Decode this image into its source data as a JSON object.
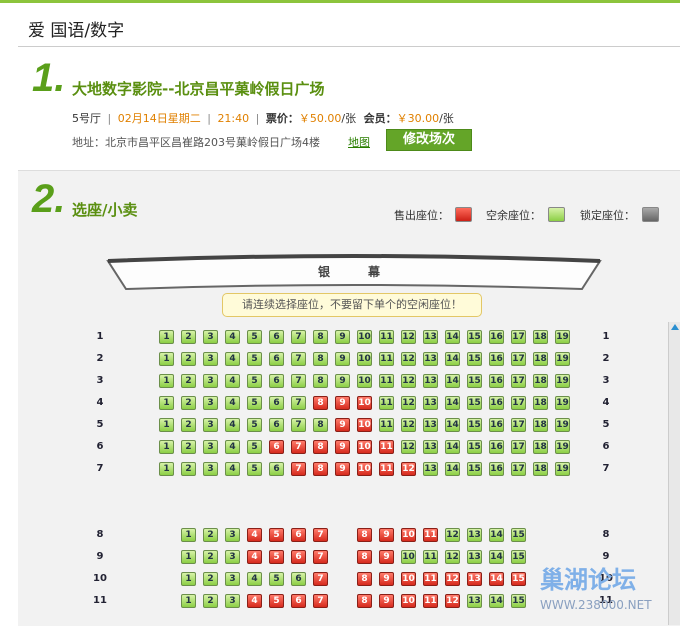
{
  "title": "爱 国语/数字",
  "step1": {
    "num": "1.",
    "cinema": "大地数字影院--北京昌平菓岭假日广场",
    "hall": "5号厅",
    "date": "02月14日星期二",
    "time": "21:40",
    "price_label": "票价：",
    "price_value": "￥50.00",
    "price_unit": "/张",
    "member_label": "会员：",
    "member_value": "￥30.00",
    "member_unit": "/张",
    "sep": "|",
    "address": "地址：北京市昌平区昌崔路203号菓岭假日广场4楼",
    "map_link": "地图",
    "change_button": "修改场次"
  },
  "step2": {
    "num": "2.",
    "label": "选座/小卖",
    "legend_sold": "售出座位：",
    "legend_free": "空余座位：",
    "legend_locked": "锁定座位：",
    "screen_left": "银",
    "screen_right": "幕",
    "tip": "请连续选择座位，不要留下单个的空闲座位！"
  },
  "colors": {
    "accent": "#5a9f1a",
    "free": "#8ccf45",
    "sold": "#d62a1d",
    "locked": "#777777"
  },
  "watermark": {
    "line1": "巢湖论坛",
    "line2": "WWW.238000.NET"
  },
  "top_rows": [
    {
      "label": "1",
      "seats": [
        {
          "n": "1",
          "s": "free"
        },
        {
          "n": "2",
          "s": "free"
        },
        {
          "n": "3",
          "s": "free"
        },
        {
          "n": "4",
          "s": "free"
        },
        {
          "n": "5",
          "s": "free"
        },
        {
          "n": "6",
          "s": "free"
        },
        {
          "n": "7",
          "s": "free"
        },
        {
          "n": "8",
          "s": "free"
        },
        {
          "n": "9",
          "s": "free"
        },
        {
          "n": "10",
          "s": "free"
        },
        {
          "n": "11",
          "s": "free"
        },
        {
          "n": "12",
          "s": "free"
        },
        {
          "n": "13",
          "s": "free"
        },
        {
          "n": "14",
          "s": "free"
        },
        {
          "n": "15",
          "s": "free"
        },
        {
          "n": "16",
          "s": "free"
        },
        {
          "n": "17",
          "s": "free"
        },
        {
          "n": "18",
          "s": "free"
        },
        {
          "n": "19",
          "s": "free"
        }
      ]
    },
    {
      "label": "2",
      "seats": [
        {
          "n": "1",
          "s": "free"
        },
        {
          "n": "2",
          "s": "free"
        },
        {
          "n": "3",
          "s": "free"
        },
        {
          "n": "4",
          "s": "free"
        },
        {
          "n": "5",
          "s": "free"
        },
        {
          "n": "6",
          "s": "free"
        },
        {
          "n": "7",
          "s": "free"
        },
        {
          "n": "8",
          "s": "free"
        },
        {
          "n": "9",
          "s": "free"
        },
        {
          "n": "10",
          "s": "free"
        },
        {
          "n": "11",
          "s": "free"
        },
        {
          "n": "12",
          "s": "free"
        },
        {
          "n": "13",
          "s": "free"
        },
        {
          "n": "14",
          "s": "free"
        },
        {
          "n": "15",
          "s": "free"
        },
        {
          "n": "16",
          "s": "free"
        },
        {
          "n": "17",
          "s": "free"
        },
        {
          "n": "18",
          "s": "free"
        },
        {
          "n": "19",
          "s": "free"
        }
      ]
    },
    {
      "label": "3",
      "seats": [
        {
          "n": "1",
          "s": "free"
        },
        {
          "n": "2",
          "s": "free"
        },
        {
          "n": "3",
          "s": "free"
        },
        {
          "n": "4",
          "s": "free"
        },
        {
          "n": "5",
          "s": "free"
        },
        {
          "n": "6",
          "s": "free"
        },
        {
          "n": "7",
          "s": "free"
        },
        {
          "n": "8",
          "s": "free"
        },
        {
          "n": "9",
          "s": "free"
        },
        {
          "n": "10",
          "s": "free"
        },
        {
          "n": "11",
          "s": "free"
        },
        {
          "n": "12",
          "s": "free"
        },
        {
          "n": "13",
          "s": "free"
        },
        {
          "n": "14",
          "s": "free"
        },
        {
          "n": "15",
          "s": "free"
        },
        {
          "n": "16",
          "s": "free"
        },
        {
          "n": "17",
          "s": "free"
        },
        {
          "n": "18",
          "s": "free"
        },
        {
          "n": "19",
          "s": "free"
        }
      ]
    },
    {
      "label": "4",
      "seats": [
        {
          "n": "1",
          "s": "free"
        },
        {
          "n": "2",
          "s": "free"
        },
        {
          "n": "3",
          "s": "free"
        },
        {
          "n": "4",
          "s": "free"
        },
        {
          "n": "5",
          "s": "free"
        },
        {
          "n": "6",
          "s": "free"
        },
        {
          "n": "7",
          "s": "free"
        },
        {
          "n": "8",
          "s": "sold"
        },
        {
          "n": "9",
          "s": "sold"
        },
        {
          "n": "10",
          "s": "sold"
        },
        {
          "n": "11",
          "s": "free"
        },
        {
          "n": "12",
          "s": "free"
        },
        {
          "n": "13",
          "s": "free"
        },
        {
          "n": "14",
          "s": "free"
        },
        {
          "n": "15",
          "s": "free"
        },
        {
          "n": "16",
          "s": "free"
        },
        {
          "n": "17",
          "s": "free"
        },
        {
          "n": "18",
          "s": "free"
        },
        {
          "n": "19",
          "s": "free"
        }
      ]
    },
    {
      "label": "5",
      "seats": [
        {
          "n": "1",
          "s": "free"
        },
        {
          "n": "2",
          "s": "free"
        },
        {
          "n": "3",
          "s": "free"
        },
        {
          "n": "4",
          "s": "free"
        },
        {
          "n": "5",
          "s": "free"
        },
        {
          "n": "6",
          "s": "free"
        },
        {
          "n": "7",
          "s": "free"
        },
        {
          "n": "8",
          "s": "free"
        },
        {
          "n": "9",
          "s": "sold"
        },
        {
          "n": "10",
          "s": "sold"
        },
        {
          "n": "11",
          "s": "free"
        },
        {
          "n": "12",
          "s": "free"
        },
        {
          "n": "13",
          "s": "free"
        },
        {
          "n": "14",
          "s": "free"
        },
        {
          "n": "15",
          "s": "free"
        },
        {
          "n": "16",
          "s": "free"
        },
        {
          "n": "17",
          "s": "free"
        },
        {
          "n": "18",
          "s": "free"
        },
        {
          "n": "19",
          "s": "free"
        }
      ]
    },
    {
      "label": "6",
      "seats": [
        {
          "n": "1",
          "s": "free"
        },
        {
          "n": "2",
          "s": "free"
        },
        {
          "n": "3",
          "s": "free"
        },
        {
          "n": "4",
          "s": "free"
        },
        {
          "n": "5",
          "s": "free"
        },
        {
          "n": "6",
          "s": "sold"
        },
        {
          "n": "7",
          "s": "sold"
        },
        {
          "n": "8",
          "s": "sold"
        },
        {
          "n": "9",
          "s": "sold"
        },
        {
          "n": "10",
          "s": "sold"
        },
        {
          "n": "11",
          "s": "sold"
        },
        {
          "n": "12",
          "s": "free"
        },
        {
          "n": "13",
          "s": "free"
        },
        {
          "n": "14",
          "s": "free"
        },
        {
          "n": "15",
          "s": "free"
        },
        {
          "n": "16",
          "s": "free"
        },
        {
          "n": "17",
          "s": "free"
        },
        {
          "n": "18",
          "s": "free"
        },
        {
          "n": "19",
          "s": "free"
        }
      ]
    },
    {
      "label": "7",
      "seats": [
        {
          "n": "1",
          "s": "free"
        },
        {
          "n": "2",
          "s": "free"
        },
        {
          "n": "3",
          "s": "free"
        },
        {
          "n": "4",
          "s": "free"
        },
        {
          "n": "5",
          "s": "free"
        },
        {
          "n": "6",
          "s": "free"
        },
        {
          "n": "7",
          "s": "sold"
        },
        {
          "n": "8",
          "s": "sold"
        },
        {
          "n": "9",
          "s": "sold"
        },
        {
          "n": "10",
          "s": "sold"
        },
        {
          "n": "11",
          "s": "sold"
        },
        {
          "n": "12",
          "s": "sold"
        },
        {
          "n": "13",
          "s": "free"
        },
        {
          "n": "14",
          "s": "free"
        },
        {
          "n": "15",
          "s": "free"
        },
        {
          "n": "16",
          "s": "free"
        },
        {
          "n": "17",
          "s": "free"
        },
        {
          "n": "18",
          "s": "free"
        },
        {
          "n": "19",
          "s": "free"
        }
      ]
    }
  ],
  "bottom_rows": [
    {
      "label": "8",
      "seats": [
        {
          "n": "1",
          "s": "free"
        },
        {
          "n": "2",
          "s": "free"
        },
        {
          "n": "3",
          "s": "free"
        },
        {
          "n": "4",
          "s": "sold"
        },
        {
          "n": "5",
          "s": "sold"
        },
        {
          "n": "6",
          "s": "sold"
        },
        {
          "n": "7",
          "s": "sold"
        },
        {
          "n": "8",
          "s": "sold"
        },
        {
          "n": "9",
          "s": "sold"
        },
        {
          "n": "10",
          "s": "sold"
        },
        {
          "n": "11",
          "s": "sold"
        },
        {
          "n": "12",
          "s": "free"
        },
        {
          "n": "13",
          "s": "free"
        },
        {
          "n": "14",
          "s": "free"
        },
        {
          "n": "15",
          "s": "free"
        }
      ]
    },
    {
      "label": "9",
      "seats": [
        {
          "n": "1",
          "s": "free"
        },
        {
          "n": "2",
          "s": "free"
        },
        {
          "n": "3",
          "s": "free"
        },
        {
          "n": "4",
          "s": "sold"
        },
        {
          "n": "5",
          "s": "sold"
        },
        {
          "n": "6",
          "s": "sold"
        },
        {
          "n": "7",
          "s": "sold"
        },
        {
          "n": "8",
          "s": "sold"
        },
        {
          "n": "9",
          "s": "sold"
        },
        {
          "n": "10",
          "s": "free"
        },
        {
          "n": "11",
          "s": "free"
        },
        {
          "n": "12",
          "s": "free"
        },
        {
          "n": "13",
          "s": "free"
        },
        {
          "n": "14",
          "s": "free"
        },
        {
          "n": "15",
          "s": "free"
        }
      ]
    },
    {
      "label": "10",
      "seats": [
        {
          "n": "1",
          "s": "free"
        },
        {
          "n": "2",
          "s": "free"
        },
        {
          "n": "3",
          "s": "free"
        },
        {
          "n": "4",
          "s": "free"
        },
        {
          "n": "5",
          "s": "free"
        },
        {
          "n": "6",
          "s": "free"
        },
        {
          "n": "7",
          "s": "sold"
        },
        {
          "n": "8",
          "s": "sold"
        },
        {
          "n": "9",
          "s": "sold"
        },
        {
          "n": "10",
          "s": "sold"
        },
        {
          "n": "11",
          "s": "sold"
        },
        {
          "n": "12",
          "s": "sold"
        },
        {
          "n": "13",
          "s": "sold"
        },
        {
          "n": "14",
          "s": "sold"
        },
        {
          "n": "15",
          "s": "sold"
        }
      ]
    },
    {
      "label": "11",
      "seats": [
        {
          "n": "1",
          "s": "free"
        },
        {
          "n": "2",
          "s": "free"
        },
        {
          "n": "3",
          "s": "free"
        },
        {
          "n": "4",
          "s": "sold"
        },
        {
          "n": "5",
          "s": "sold"
        },
        {
          "n": "6",
          "s": "sold"
        },
        {
          "n": "7",
          "s": "sold"
        },
        {
          "n": "8",
          "s": "sold"
        },
        {
          "n": "9",
          "s": "sold"
        },
        {
          "n": "10",
          "s": "sold"
        },
        {
          "n": "11",
          "s": "sold"
        },
        {
          "n": "12",
          "s": "sold"
        },
        {
          "n": "13",
          "s": "free"
        },
        {
          "n": "14",
          "s": "free"
        },
        {
          "n": "15",
          "s": "free"
        }
      ]
    }
  ]
}
